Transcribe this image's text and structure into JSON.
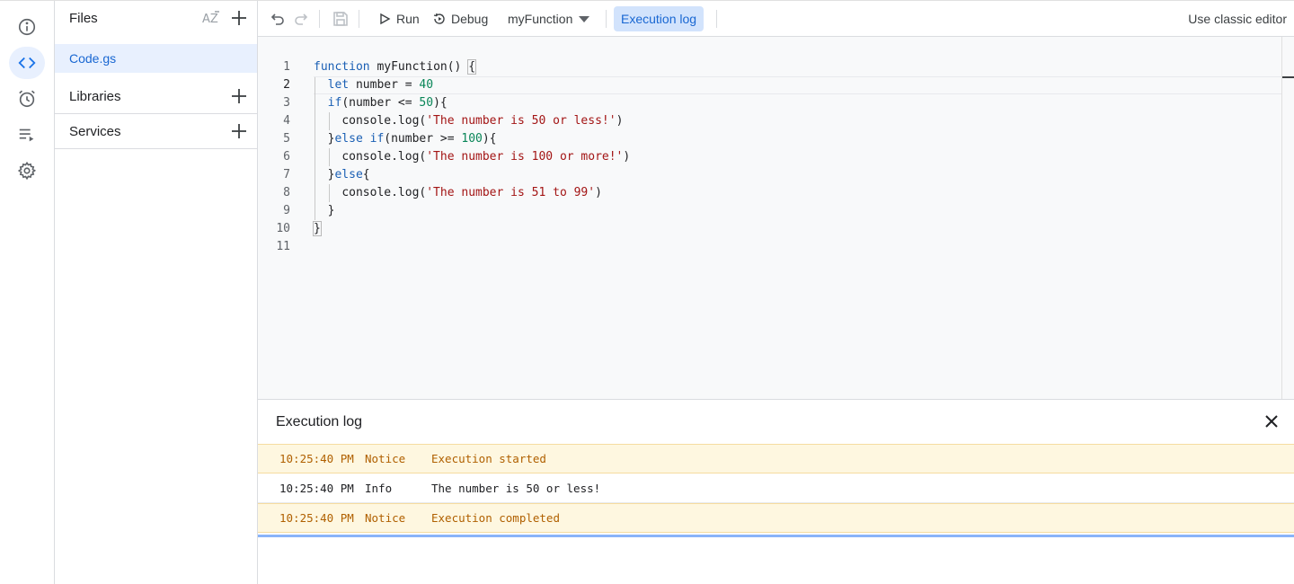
{
  "rail": {
    "items": [
      {
        "name": "overview",
        "icon": "info-icon"
      },
      {
        "name": "editor",
        "icon": "code-icon",
        "active": true
      },
      {
        "name": "triggers",
        "icon": "alarm-icon"
      },
      {
        "name": "executions",
        "icon": "executions-icon"
      },
      {
        "name": "settings",
        "icon": "gear-icon"
      }
    ]
  },
  "files_panel": {
    "title": "Files",
    "sort_icon": "sort-az-icon",
    "files": [
      {
        "name": "Code.gs",
        "selected": true
      }
    ],
    "libraries_label": "Libraries",
    "services_label": "Services"
  },
  "toolbar": {
    "run_label": "Run",
    "debug_label": "Debug",
    "function_selector": "myFunction",
    "execution_log_label": "Execution log",
    "classic_editor_label": "Use classic editor"
  },
  "editor": {
    "current_line": 2,
    "lines": [
      {
        "n": "1"
      },
      {
        "n": "2"
      },
      {
        "n": "3"
      },
      {
        "n": "4"
      },
      {
        "n": "5"
      },
      {
        "n": "6"
      },
      {
        "n": "7"
      },
      {
        "n": "8"
      },
      {
        "n": "9"
      },
      {
        "n": "10"
      },
      {
        "n": "11"
      }
    ],
    "tokens": {
      "function_kw": "function",
      "fn_name": " myFunction() ",
      "open_brace": "{",
      "let_kw": "let",
      "number_decl": " number = ",
      "val_40": "40",
      "if_kw": "if",
      "cond1": "(number <= ",
      "val_50": "50",
      "close_cond": "){",
      "log_call": "console.log(",
      "str1": "'The number is 50 or less!'",
      "close_paren": ")",
      "close_brace_else": "}",
      "else_kw": "else",
      "space_if": " if",
      "cond2": "(number >= ",
      "val_100": "100",
      "str2": "'The number is 100 or more!'",
      "else_open": "{",
      "str3": "'The number is 51 to 99'",
      "inner_close": "}",
      "outer_close": "}"
    }
  },
  "execution_log": {
    "title": "Execution log",
    "rows": [
      {
        "time": "10:25:40 PM",
        "severity": "Notice",
        "message": "Execution started"
      },
      {
        "time": "10:25:40 PM",
        "severity": "Info",
        "message": "The number is 50 or less!"
      },
      {
        "time": "10:25:40 PM",
        "severity": "Notice",
        "message": "Execution completed"
      }
    ]
  },
  "colors": {
    "accent": "#1a73e8",
    "notice_bg": "#fef7e0",
    "notice_text": "#b06000",
    "string": "#a31515",
    "number": "#098658",
    "keyword": "#1a5fb4"
  }
}
